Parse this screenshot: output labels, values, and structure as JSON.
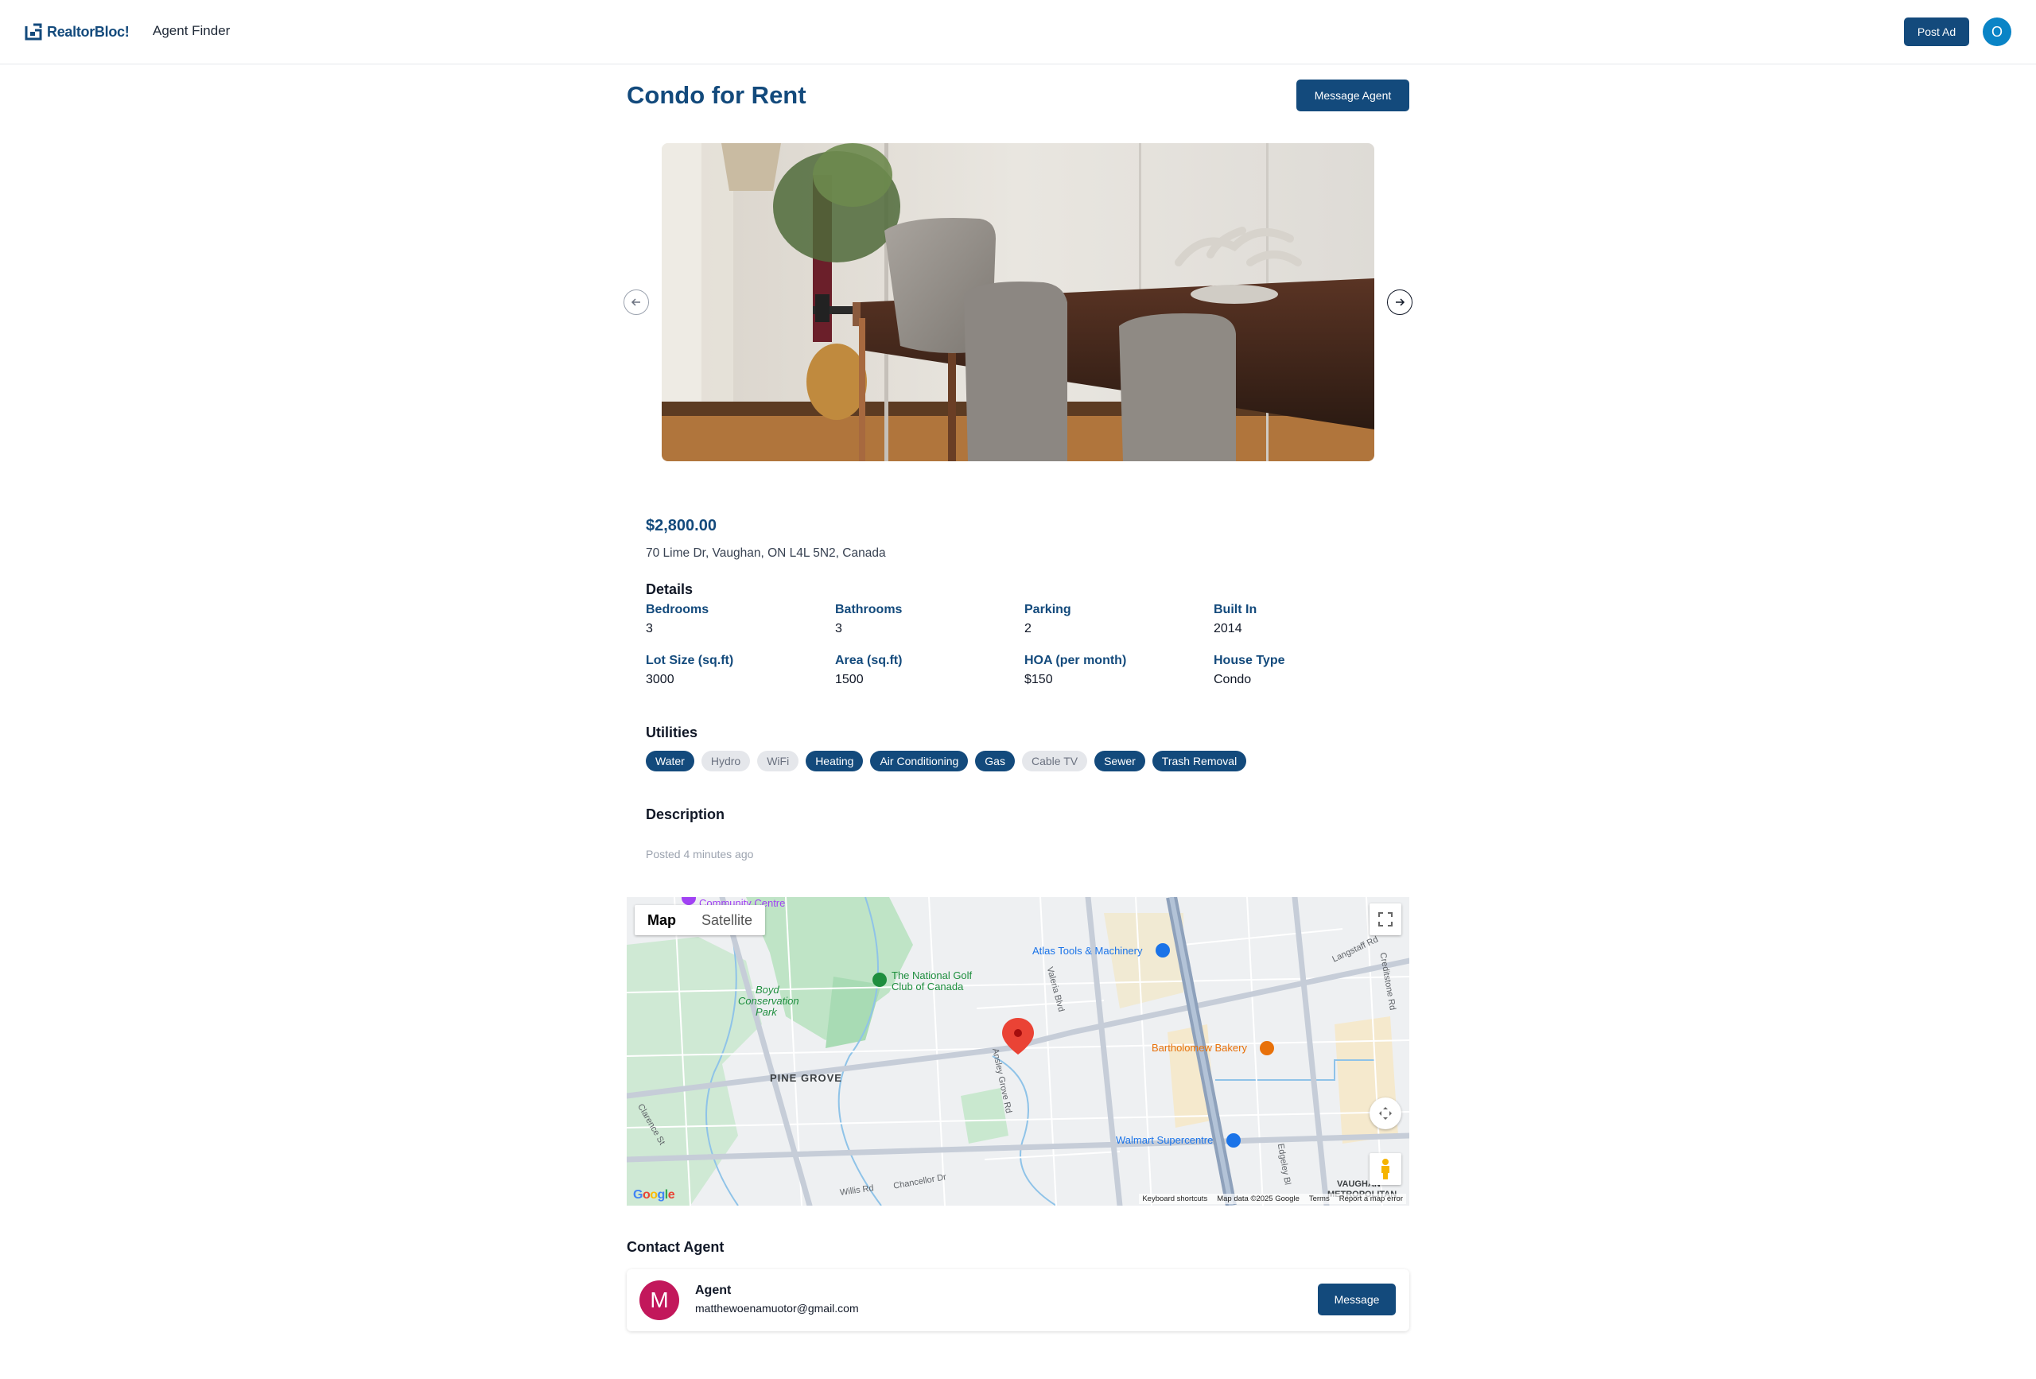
{
  "nav": {
    "brand": "RealtorBloc!",
    "links": [
      "Agent Finder"
    ],
    "post_ad": "Post Ad",
    "user_initial": "O"
  },
  "listing": {
    "title": "Condo for Rent",
    "message_agent": "Message Agent",
    "price": "$2,800.00",
    "address": "70 Lime Dr, Vaughan, ON L4L 5N2, Canada",
    "details_heading": "Details",
    "details": [
      {
        "label": "Bedrooms",
        "value": "3"
      },
      {
        "label": "Bathrooms",
        "value": "3"
      },
      {
        "label": "Parking",
        "value": "2"
      },
      {
        "label": "Built In",
        "value": "2014"
      },
      {
        "label": "Lot Size (sq.ft)",
        "value": "3000"
      },
      {
        "label": "Area (sq.ft)",
        "value": "1500"
      },
      {
        "label": "HOA (per month)",
        "value": "$150"
      },
      {
        "label": "House Type",
        "value": "Condo"
      }
    ],
    "utilities_heading": "Utilities",
    "utilities": [
      {
        "label": "Water",
        "active": true
      },
      {
        "label": "Hydro",
        "active": false
      },
      {
        "label": "WiFi",
        "active": false
      },
      {
        "label": "Heating",
        "active": true
      },
      {
        "label": "Air Conditioning",
        "active": true
      },
      {
        "label": "Gas",
        "active": true
      },
      {
        "label": "Cable TV",
        "active": false
      },
      {
        "label": "Sewer",
        "active": true
      },
      {
        "label": "Trash Removal",
        "active": true
      }
    ],
    "description_heading": "Description",
    "posted": "Posted 4 minutes ago"
  },
  "map": {
    "type_map": "Map",
    "type_satellite": "Satellite",
    "labels": {
      "community": "Community Centre",
      "atlas": "Atlas Tools & Machinery",
      "golf_1": "The National Golf",
      "golf_2": "Club of Canada",
      "boyd_1": "Boyd",
      "boyd_2": "Conservation",
      "boyd_3": "Park",
      "pine_grove": "PINE GROVE",
      "bakery": "Bartholomew Bakery",
      "walmart": "Walmart Supercentre",
      "valeria": "Valeria Blvd",
      "ansley": "Ansley Grove Rd",
      "chancellor": "Chancellor Dr",
      "willis": "Willis Rd",
      "clarence": "Clarence St",
      "langstaff": "Langstaff Rd",
      "creditstone": "Creditstone Rd",
      "edgeley": "Edgeley Bl",
      "vaughan": "VAUGHAN",
      "metro": "METROPOLITAN"
    },
    "footer": [
      "Keyboard shortcuts",
      "Map data ©2025 Google",
      "Terms",
      "Report a map error"
    ],
    "google": "Google"
  },
  "contact": {
    "heading": "Contact Agent",
    "avatar_initial": "M",
    "name": "Agent",
    "email": "matthewoenamuotor@gmail.com",
    "message": "Message"
  },
  "colors": {
    "brand": "#134a7c",
    "user_avatar": "#0a84c6",
    "agent_avatar": "#c2185b",
    "pill_inactive": "#e5e7eb"
  }
}
